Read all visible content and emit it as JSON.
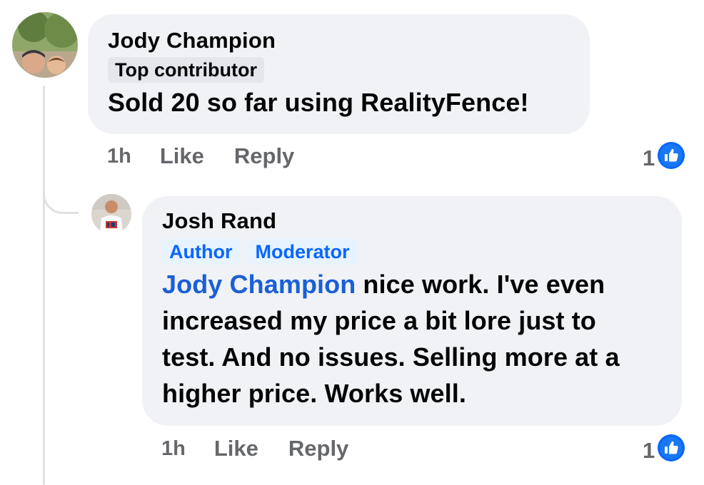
{
  "comments": [
    {
      "author": "Jody Champion",
      "badges": [
        "Top contributor"
      ],
      "text": "Sold 20 so far using RealityFence!",
      "time": "1h",
      "like_label": "Like",
      "reply_label": "Reply",
      "reaction_count": "1",
      "reaction_icon": "thumbs-up-icon"
    },
    {
      "author": "Josh Rand",
      "badges": [
        "Author",
        "Moderator"
      ],
      "mention": "Jody Champion",
      "text_lines": [
        " nice work. I've even",
        "increased my price a bit lore just to",
        "test. And no issues. Selling more at a",
        "higher price. Works well."
      ],
      "time": "1h",
      "like_label": "Like",
      "reply_label": "Reply",
      "reaction_count": "1",
      "reaction_icon": "thumbs-up-icon"
    }
  ],
  "colors": {
    "bubble": "#f0f2f5",
    "secondary_text": "#65676b",
    "mention": "#1a5fd6",
    "reaction_blue": "#0866ff"
  }
}
